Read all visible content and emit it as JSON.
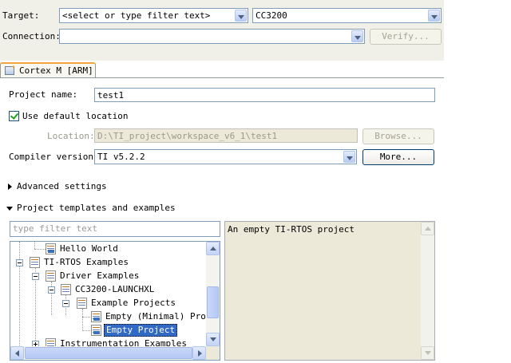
{
  "form": {
    "target": {
      "label": "Target:",
      "filter_value": "<select or type filter text>",
      "device_value": "CC3200"
    },
    "connection": {
      "label": "Connection:",
      "value": "",
      "verify_label": "Verify..."
    },
    "tab": {
      "label": "Cortex M [ARM]"
    },
    "project_name": {
      "label": "Project name:",
      "value": "test1"
    },
    "use_default": {
      "label": "Use default location",
      "checked": true
    },
    "location": {
      "label": "Location:",
      "value": "D:\\TI_project\\workspace_v6_1\\test1",
      "browse_label": "Browse..."
    },
    "compiler": {
      "label": "Compiler version:",
      "value": "TI v5.2.2",
      "more_label": "More..."
    },
    "advanced": {
      "label": "Advanced settings"
    },
    "templates": {
      "label": "Project templates and examples",
      "filter_placeholder": "type filter text",
      "tree": [
        {
          "label": "Hello World",
          "level": 2,
          "expander": "none",
          "selected": false
        },
        {
          "label": "TI-RTOS Examples",
          "level": 0,
          "expander": "minus",
          "selected": false
        },
        {
          "label": "Driver Examples",
          "level": 1,
          "expander": "minus",
          "selected": false
        },
        {
          "label": "CC3200-LAUNCHXL",
          "level": 2,
          "expander": "minus",
          "selected": false
        },
        {
          "label": "Example Projects",
          "level": 3,
          "expander": "minus",
          "selected": false
        },
        {
          "label": "Empty (Minimal) Proje",
          "level": 4,
          "expander": "none",
          "selected": false
        },
        {
          "label": "Empty Project",
          "level": 4,
          "expander": "none",
          "selected": true
        },
        {
          "label": "Instrumentation Examples",
          "level": 1,
          "expander": "plus",
          "selected": false
        }
      ],
      "description": "An empty TI-RTOS project"
    }
  },
  "colors": {
    "accent_tab": "#f3a33b",
    "selection": "#316ac5",
    "panel": "#f0f0e8",
    "field_border": "#7f9db9"
  }
}
